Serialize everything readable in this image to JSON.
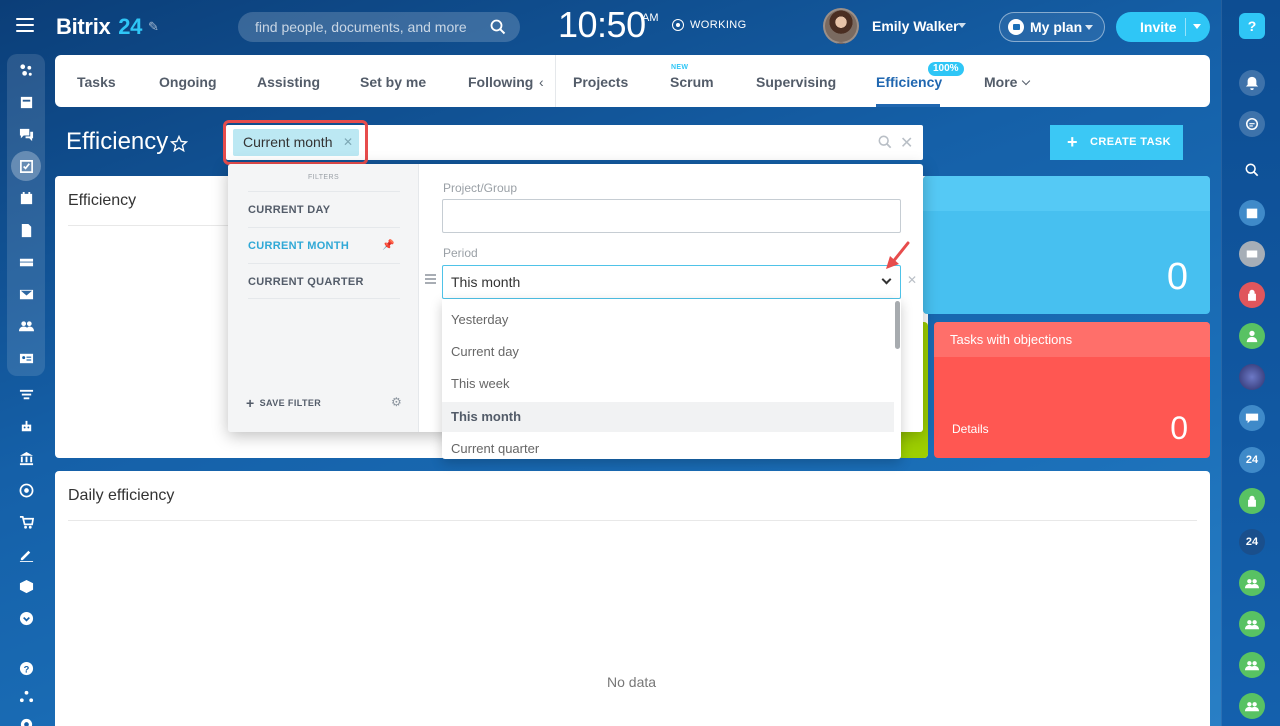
{
  "header": {
    "logo_text": "Bitrix",
    "logo_num": "24",
    "search_placeholder": "find people, documents, and more",
    "clock": "10:50",
    "clock_ampm": "AM",
    "work_status": "WORKING",
    "user_name": "Emily Walker",
    "my_plan_label": "My plan",
    "invite_label": "Invite"
  },
  "tabs": [
    {
      "label": "Tasks"
    },
    {
      "label": "Ongoing"
    },
    {
      "label": "Assisting"
    },
    {
      "label": "Set by me"
    },
    {
      "label": "Following"
    },
    {
      "label": "Projects"
    },
    {
      "label": "Scrum",
      "tag": "NEW"
    },
    {
      "label": "Supervising"
    },
    {
      "label": "Efficiency",
      "badge": "100%"
    },
    {
      "label": "More"
    }
  ],
  "page": {
    "title": "Efficiency",
    "filter_chip": "Current month",
    "create_task_label": "CREATE TASK"
  },
  "filter_popup": {
    "header": "FILTERS",
    "presets": [
      "CURRENT DAY",
      "CURRENT MONTH",
      "CURRENT QUARTER"
    ],
    "active_preset": "CURRENT MONTH",
    "save_filter_label": "SAVE FILTER",
    "project_group_label": "Project/Group",
    "project_group_value": "",
    "period_label": "Period",
    "period_value": "This month",
    "period_options": [
      "Yesterday",
      "Current day",
      "This week",
      "This month",
      "Current quarter"
    ],
    "selected_option": "This month"
  },
  "panels": {
    "efficiency_title": "Efficiency",
    "blue_card_value": "0",
    "red_card_title": "Tasks with objections",
    "red_card_details": "Details",
    "red_card_value": "0",
    "daily_title": "Daily efficiency",
    "no_data": "No data"
  },
  "right_bar": {
    "help_label": "?",
    "badge_24": "24"
  },
  "colors": {
    "accent": "#2fc6f6",
    "tab_active": "#2067b0",
    "card_blue": "#47c0f0",
    "card_red": "#ff5752",
    "card_green": "#9dcf00",
    "highlight_red": "#e74c4c"
  }
}
